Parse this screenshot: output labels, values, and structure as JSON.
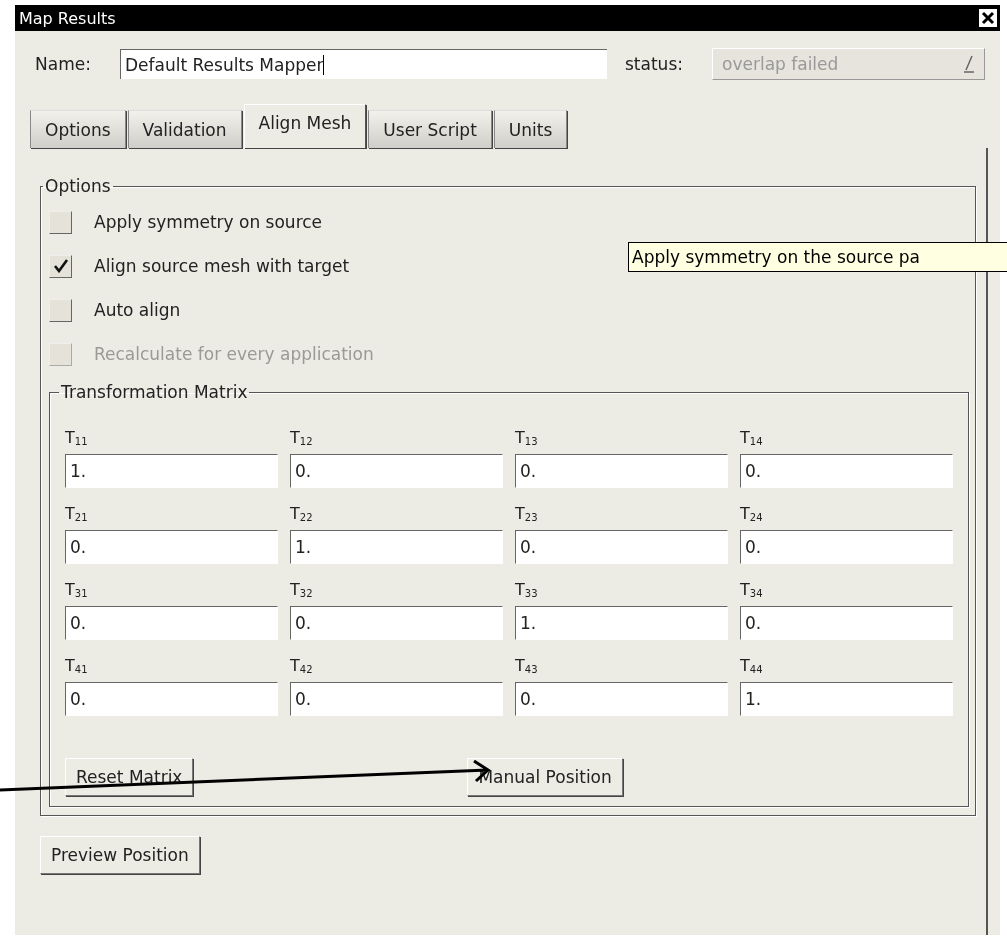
{
  "window": {
    "title": "Map Results"
  },
  "name_field": {
    "label": "Name:",
    "value": "Default Results Mapper"
  },
  "status_field": {
    "label": "status:",
    "value": "overlap failed",
    "disabled": true
  },
  "tabs": [
    {
      "label": "Options",
      "selected": false
    },
    {
      "label": "Validation",
      "selected": false
    },
    {
      "label": "Align Mesh",
      "selected": true
    },
    {
      "label": "User Script",
      "selected": false
    },
    {
      "label": "Units",
      "selected": false
    }
  ],
  "options_group": {
    "title": "Options",
    "checkboxes": [
      {
        "label": "Apply symmetry on source",
        "checked": false,
        "disabled": false
      },
      {
        "label": "Align source mesh with target",
        "checked": true,
        "disabled": false
      },
      {
        "label": "Auto align",
        "checked": false,
        "disabled": false
      },
      {
        "label": "Recalculate for every application",
        "checked": false,
        "disabled": true
      }
    ]
  },
  "matrix_group": {
    "title": "Transformation Matrix",
    "cells": [
      [
        {
          "label": "T$_{11}$",
          "value": "1."
        },
        {
          "label": "T$_{12}$",
          "value": "0."
        },
        {
          "label": "T$_{13}$",
          "value": "0."
        },
        {
          "label": "T$_{14}$",
          "value": "0."
        }
      ],
      [
        {
          "label": "T$_{21}$",
          "value": "0."
        },
        {
          "label": "T$_{22}$",
          "value": "1."
        },
        {
          "label": "T$_{23}$",
          "value": "0."
        },
        {
          "label": "T$_{24}$",
          "value": "0."
        }
      ],
      [
        {
          "label": "T$_{31}$",
          "value": "0."
        },
        {
          "label": "T$_{32}$",
          "value": "0."
        },
        {
          "label": "T$_{33}$",
          "value": "1."
        },
        {
          "label": "T$_{34}$",
          "value": "0."
        }
      ],
      [
        {
          "label": "T$_{41}$",
          "value": "0."
        },
        {
          "label": "T$_{42}$",
          "value": "0."
        },
        {
          "label": "T$_{43}$",
          "value": "0."
        },
        {
          "label": "T$_{44}$",
          "value": "1."
        }
      ]
    ],
    "buttons": [
      "Reset Matrix",
      "Manual Position"
    ]
  },
  "bottom_buttons": [
    "Preview Position"
  ],
  "tooltip": {
    "text": "Apply symmetry on the source pa"
  }
}
